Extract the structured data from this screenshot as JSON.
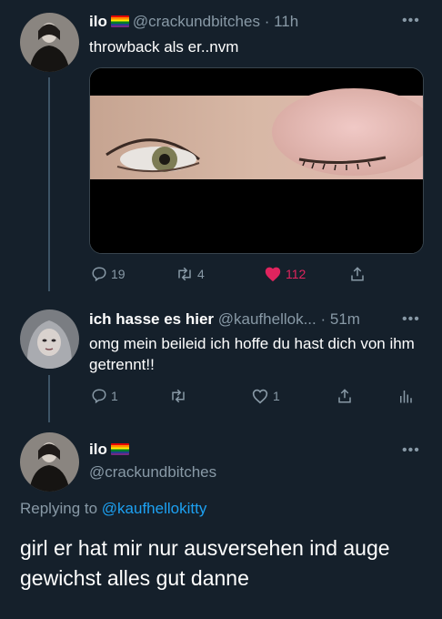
{
  "tweet1": {
    "name": "ilo",
    "handle": "@crackundbitches",
    "time": "· 11h",
    "text": "throwback als er..nvm",
    "more": "•••",
    "replies": "19",
    "retweets": "4",
    "likes": "112"
  },
  "tweet2": {
    "name": "ich hasse es hier",
    "handle": "@kaufhellok...",
    "time": "· 51m",
    "text": "omg mein beileid ich hoffe du hast dich von ihm getrennt!!",
    "more": "•••",
    "replies": "1",
    "likes": "1"
  },
  "tweet3": {
    "name": "ilo",
    "handle": "@crackundbitches",
    "more": "•••",
    "replying_prefix": "Replying to",
    "replying_to": "@kaufhellokitty",
    "text": "girl er hat mir nur ausversehen ind auge gewichst alles gut danne"
  },
  "colors": {
    "background": "#15202b",
    "secondary_text": "#8899a6",
    "link": "#1da1f2",
    "like_active": "#e0245e"
  }
}
